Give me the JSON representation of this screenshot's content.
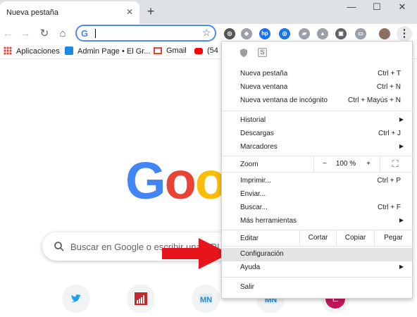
{
  "tab": {
    "title": "Nueva pestaña",
    "close": "✕",
    "new_tab": "+"
  },
  "window": {
    "minimize": "—",
    "maximize": "☐",
    "close": "✕"
  },
  "toolbar": {
    "back": "←",
    "forward": "→",
    "reload": "↻",
    "home": "⌂",
    "omnibox_g": "G",
    "bookmark": "☆",
    "menu": "⋮"
  },
  "extensions": [
    {
      "name": "puzzle",
      "text": "◎",
      "color": "#555555"
    },
    {
      "name": "dropbox",
      "text": "◆",
      "color": "#9aa0a6"
    },
    {
      "name": "hp",
      "text": "hp",
      "color": "#1a73e8"
    },
    {
      "name": "circle-ext",
      "text": "◎",
      "color": "#1a73e8"
    },
    {
      "name": "tag",
      "text": "▰",
      "color": "#9aa0a6"
    },
    {
      "name": "drive",
      "text": "▲",
      "color": "#9aa0a6"
    },
    {
      "name": "pip",
      "text": "▣",
      "color": "#5f6368"
    },
    {
      "name": "cast",
      "text": "▭",
      "color": "#9aa0a6"
    }
  ],
  "bookmarks": [
    {
      "label": "Aplicaciones"
    },
    {
      "label": "Admin Page • El Gr..."
    },
    {
      "label": "Gmail"
    },
    {
      "label": "(54"
    }
  ],
  "page": {
    "logo_letters": [
      {
        "ch": "G",
        "color": "#4285f4"
      },
      {
        "ch": "o",
        "color": "#ea4335"
      },
      {
        "ch": "o",
        "color": "#fbbc05"
      }
    ],
    "search_placeholder": "Buscar en Google o escribir una URL",
    "shortcuts": [
      {
        "name": "twitter",
        "text": "🐦",
        "color": "#1da1f2"
      },
      {
        "name": "stats",
        "text": "▮",
        "color": "#d93025"
      },
      {
        "name": "mn-1",
        "text": "MN",
        "color": "#4aa3df"
      },
      {
        "name": "mn-2",
        "text": "MN",
        "color": "#4aa3df"
      },
      {
        "name": "e",
        "text": "E",
        "color": "#c2185b"
      }
    ]
  },
  "menu": {
    "header_icons": [
      "shield",
      "S"
    ],
    "items": {
      "nueva_pestana": {
        "label": "Nueva pestaña",
        "shortcut": "Ctrl + T"
      },
      "nueva_ventana": {
        "label": "Nueva ventana",
        "shortcut": "Ctrl + N"
      },
      "incognito": {
        "label": "Nueva ventana de incógnito",
        "shortcut": "Ctrl + Mayús + N"
      },
      "historial": {
        "label": "Historial"
      },
      "descargas": {
        "label": "Descargas",
        "shortcut": "Ctrl + J"
      },
      "marcadores": {
        "label": "Marcadores"
      },
      "imprimir": {
        "label": "Imprimir...",
        "shortcut": "Ctrl + P"
      },
      "enviar": {
        "label": "Enviar..."
      },
      "buscar": {
        "label": "Buscar...",
        "shortcut": "Ctrl + F"
      },
      "mas_herramientas": {
        "label": "Más herramientas"
      },
      "configuracion": {
        "label": "Configuración"
      },
      "ayuda": {
        "label": "Ayuda"
      },
      "salir": {
        "label": "Salir"
      }
    },
    "zoom": {
      "label": "Zoom",
      "minus": "−",
      "value": "100 %",
      "plus": "+",
      "fullscreen": "⛶"
    },
    "edit": {
      "label": "Editar",
      "cut": "Cortar",
      "copy": "Copiar",
      "paste": "Pegar"
    },
    "submenu_arrow": "▶"
  }
}
